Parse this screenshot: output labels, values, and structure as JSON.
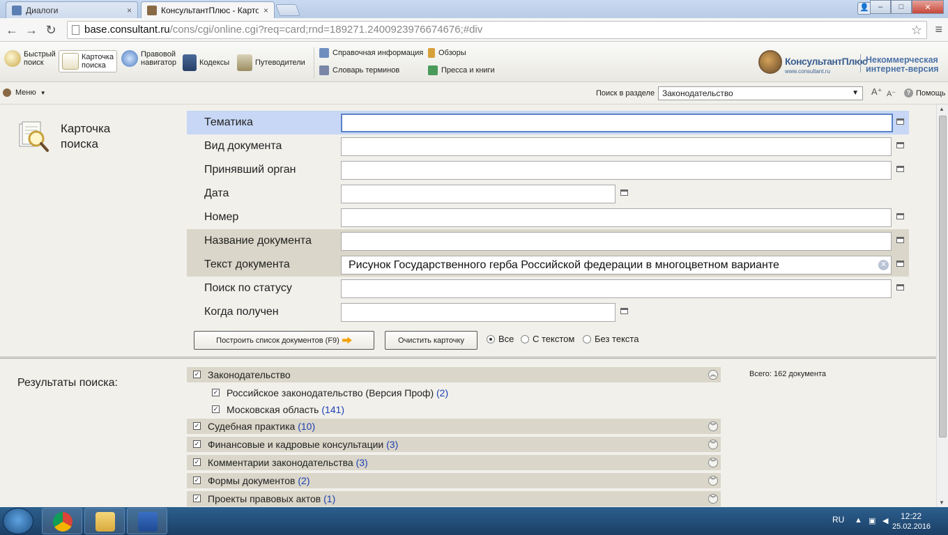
{
  "browser": {
    "tabs": [
      {
        "label": "Диалоги",
        "close": "×"
      },
      {
        "label": "КонсультантПлюс - Карто",
        "close": "×"
      }
    ],
    "url_domain": "base.consultant.ru",
    "url_rest": "/cons/cgi/online.cgi?req=card;rnd=189271.2400923976674676;#div",
    "window_buttons": {
      "minimize": "–",
      "maximize": "□",
      "close": "✕"
    }
  },
  "toolbar": {
    "items": [
      {
        "label_1": "Быстрый",
        "label_2": "поиск"
      },
      {
        "label_1": "Карточка",
        "label_2": "поиска"
      },
      {
        "label_1": "Правовой",
        "label_2": "навигатор"
      },
      {
        "label_1": "Кодексы"
      },
      {
        "label_1": "Путеводители"
      }
    ],
    "links": {
      "reference": "Справочная информация",
      "reviews": "Обзоры",
      "glossary": "Словарь терминов",
      "press": "Пресса и книги"
    },
    "logo_name": "КонсультантПлюс",
    "logo_url": "www.consultant.ru",
    "logo_note_1": "Некоммерческая",
    "logo_note_2": "интернет-версия"
  },
  "menurow": {
    "menu_label": "Меню",
    "search_in_section": "Поиск в разделе",
    "section_value": "Законодательство",
    "help": "Помощь"
  },
  "card": {
    "title_1": "Карточка",
    "title_2": "поиска",
    "fields": [
      {
        "label": "Тематика",
        "value": ""
      },
      {
        "label": "Вид документа",
        "value": ""
      },
      {
        "label": "Принявший орган",
        "value": ""
      },
      {
        "label": "Дата",
        "value": ""
      },
      {
        "label": "Номер",
        "value": ""
      },
      {
        "label": "Название документа",
        "value": ""
      },
      {
        "label": "Текст документа",
        "value": "Рисунок Государственного герба Российской федерации в многоцветном варианте"
      },
      {
        "label": "Поиск по статусу",
        "value": ""
      },
      {
        "label": "Когда получен",
        "value": ""
      }
    ],
    "build_list": "Построить список документов (F9)",
    "clear_card": "Очистить карточку",
    "radio_all": "Все",
    "radio_with_text": "С текстом",
    "radio_without_text": "Без текста"
  },
  "results": {
    "label": "Результаты поиска:",
    "total": "Всего: 162 документа",
    "groups": [
      {
        "label": "Законодательство",
        "count": ""
      },
      {
        "label": "Российское законодательство (Версия Проф)",
        "count": "(2)"
      },
      {
        "label": "Московская область",
        "count": "(141)"
      },
      {
        "label": "Судебная практика",
        "count": "(10)"
      },
      {
        "label": "Финансовые и кадровые консультации",
        "count": "(3)"
      },
      {
        "label": "Комментарии законодательства",
        "count": "(3)"
      },
      {
        "label": "Формы документов",
        "count": "(2)"
      },
      {
        "label": "Проекты правовых актов",
        "count": "(1)"
      }
    ]
  },
  "taskbar": {
    "lang": "RU",
    "time": "12:22",
    "date": "25.02.2016"
  },
  "colors": {
    "focused_row": "#c7d7f5",
    "text_rows": "#dad6c9",
    "count_link": "#1a3fb3",
    "taskbar": "#1b3f66"
  }
}
